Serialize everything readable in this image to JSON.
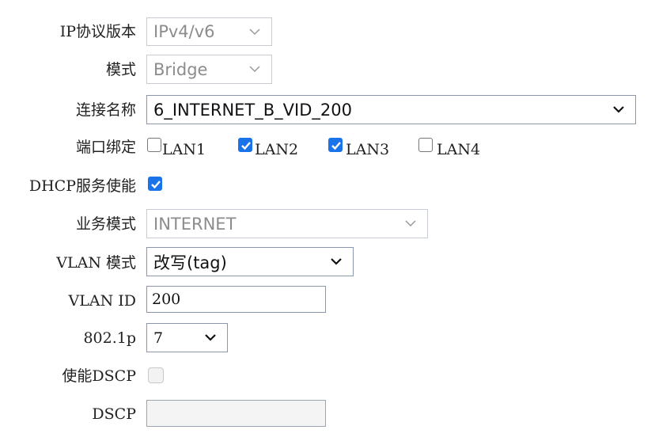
{
  "form": {
    "ip_version": {
      "label": "IP协议版本",
      "value": "IPv4/v6",
      "disabled": true
    },
    "mode": {
      "label": "模式",
      "value": "Bridge",
      "disabled": true
    },
    "connection_name": {
      "label": "连接名称",
      "value": "6_INTERNET_B_VID_200"
    },
    "port_binding": {
      "label": "端口绑定",
      "ports": [
        {
          "name": "LAN1",
          "checked": false
        },
        {
          "name": "LAN2",
          "checked": true
        },
        {
          "name": "LAN3",
          "checked": true
        },
        {
          "name": "LAN4",
          "checked": false
        }
      ]
    },
    "dhcp_service": {
      "label": "DHCP服务使能",
      "checked": true
    },
    "service_mode": {
      "label": "业务模式",
      "value": "INTERNET",
      "disabled": true
    },
    "vlan_mode": {
      "label": "VLAN 模式",
      "value": "改写(tag)"
    },
    "vlan_id": {
      "label": "VLAN ID",
      "value": "200"
    },
    "priority_8021p": {
      "label": "802.1p",
      "value": "7"
    },
    "enable_dscp": {
      "label": "使能DSCP",
      "checked": false,
      "disabled": true
    },
    "dscp": {
      "label": "DSCP",
      "value": "",
      "disabled": true
    }
  },
  "colors": {
    "accent": "#1a73e8",
    "border": "#8a98ab",
    "disabled_text": "#8c8c8c"
  }
}
